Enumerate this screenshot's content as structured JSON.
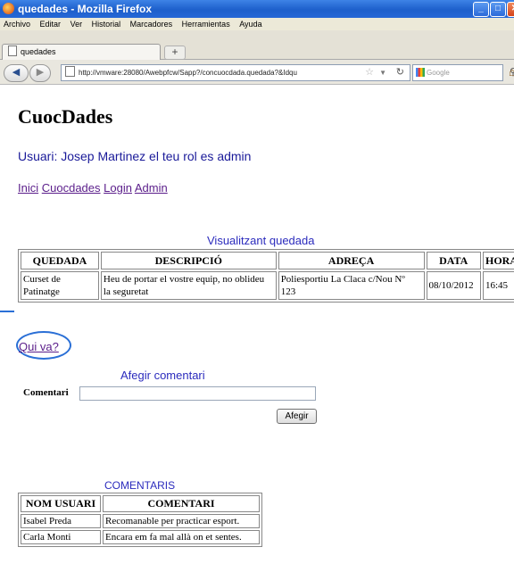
{
  "window": {
    "title": "quedades - Mozilla Firefox"
  },
  "menubar": {
    "items": [
      "Archivo",
      "Editar",
      "Ver",
      "Historial",
      "Marcadores",
      "Herramientas",
      "Ayuda"
    ]
  },
  "tabs": [
    {
      "label": "quedades"
    }
  ],
  "address": {
    "url": "http://vmware:28080/Awebpfcw/Sapp?/concuocdada.quedada?&Idqu",
    "search_placeholder": "Google"
  },
  "page": {
    "title": "CuocDades",
    "user_line": "Usuari: Josep Martinez el teu rol es admin",
    "nav_links": [
      "Inici",
      "Cuocdades",
      "Login",
      "Admin"
    ],
    "visual_title": "Visualitzant quedada",
    "quedada_table": {
      "headers": [
        "QUEDADA",
        "DESCRIPCIÓ",
        "ADREÇA",
        "DATA",
        "HORA"
      ],
      "row": [
        "Curset de Patinatge",
        "Heu de portar el vostre equip, no oblideu la seguretat",
        "Poliesportiu La Claca c/Nou Nº 123",
        "08/10/2012",
        "16:45"
      ]
    },
    "qui_va": "Qui va?",
    "afegir_title": "Afegir comentari",
    "comentari_label": "Comentari",
    "comentari_value": "",
    "afegir_button": "Afegir",
    "comentaris_title": "COMENTARIS",
    "comentaris_table": {
      "headers": [
        "NOM USUARI",
        "COMENTARI"
      ],
      "rows": [
        [
          "Isabel Preda",
          "Recomanable per practicar esport."
        ],
        [
          "Carla Monti",
          "Encara em fa mal allà on et sentes."
        ]
      ]
    }
  },
  "colors": {
    "titlebar": "#1d5fcb",
    "link": "#5a1d8a",
    "heading_blue": "#2b2bbd",
    "annotation": "#2a6fd6"
  }
}
